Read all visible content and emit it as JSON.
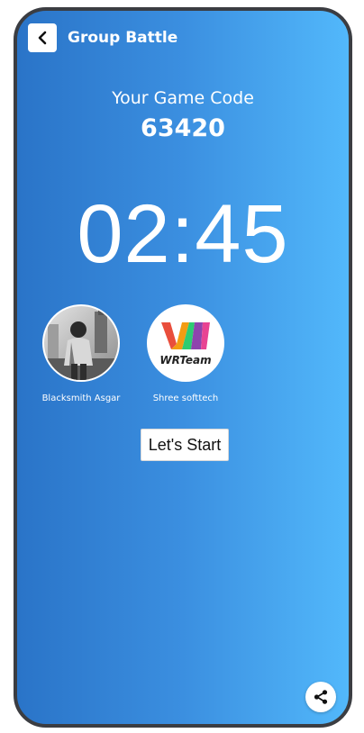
{
  "header": {
    "title": "Group Battle",
    "back_icon": "chevron-left-icon"
  },
  "game": {
    "code_label": "Your Game Code",
    "code": "63420",
    "timer": "02:45"
  },
  "players": [
    {
      "name": "Blacksmith Asgar"
    },
    {
      "name": "Shree softtech"
    }
  ],
  "actions": {
    "start_label": "Let's Start",
    "share_icon": "share-icon"
  },
  "colors": {
    "gradient_left": "#2a74c8",
    "gradient_right": "#52b8fb",
    "frame": "#3b3d42",
    "text": "#ffffff"
  }
}
